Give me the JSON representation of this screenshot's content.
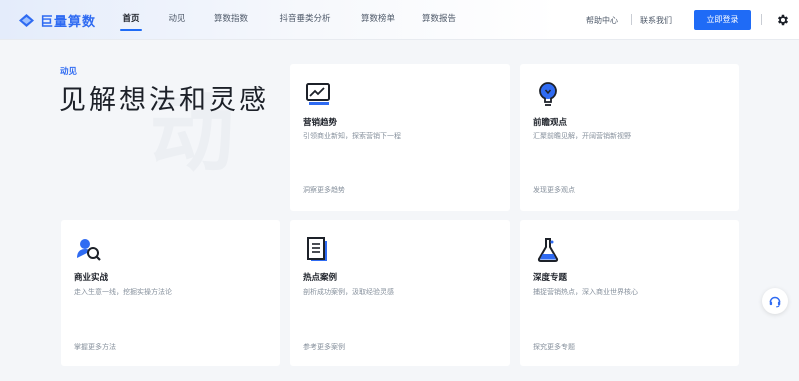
{
  "header": {
    "logo_text": "巨量算数",
    "nav": [
      {
        "label": "首页",
        "active": true
      },
      {
        "label": "动见",
        "active": false
      },
      {
        "label": "算数指数",
        "active": false
      },
      {
        "label": "抖音垂类分析",
        "active": false
      },
      {
        "label": "算数榜单",
        "active": false
      },
      {
        "label": "算数报告",
        "active": false
      }
    ],
    "help_label": "帮助中心",
    "contact_label": "联系我们",
    "login_label": "立即登录"
  },
  "hero": {
    "tag": "动见",
    "title": "见解想法和灵感",
    "watermark": "动"
  },
  "cards": [
    {
      "title": "营销趋势",
      "desc": "引领商业新知，探索营销下一程",
      "link": "洞察更多趋势",
      "icon": "trend-chart-icon"
    },
    {
      "title": "前瞻观点",
      "desc": "汇聚前瞻见解，开阔营销新视野",
      "link": "发现更多观点",
      "icon": "lightbulb-icon"
    },
    {
      "title": "商业实战",
      "desc": "走入生意一线，挖掘实操方法论",
      "link": "掌握更多方法",
      "icon": "person-search-icon"
    },
    {
      "title": "热点案例",
      "desc": "剖析成功案例，汲取经验灵感",
      "link": "参考更多案例",
      "icon": "document-icon"
    },
    {
      "title": "深度专题",
      "desc": "捕捉营销热点，深入商业世界核心",
      "link": "探究更多专题",
      "icon": "flask-icon"
    }
  ],
  "colors": {
    "brand": "#1f6bf6",
    "text": "#1d2129",
    "muted": "#86909c",
    "bg": "#f4f6f9"
  }
}
